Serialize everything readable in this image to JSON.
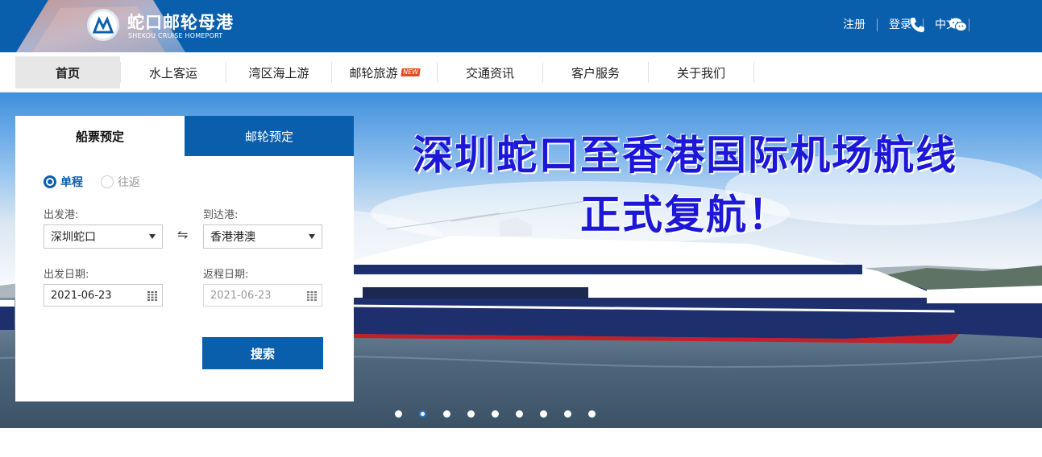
{
  "brand": {
    "name_cn": "蛇口邮轮母港",
    "name_en": "SHEKOU CRUISE HOMEPORT",
    "primary_color": "#0a5fad"
  },
  "top_links": {
    "register": "注册",
    "login": "登录",
    "language": "中文",
    "phone_icon": "phone-icon",
    "wechat_icon": "wechat-icon"
  },
  "nav": {
    "items": [
      {
        "label": "首页",
        "active": true
      },
      {
        "label": "水上客运"
      },
      {
        "label": "湾区海上游"
      },
      {
        "label": "邮轮旅游",
        "badge": "NEW"
      },
      {
        "label": "交通资讯"
      },
      {
        "label": "客户服务"
      },
      {
        "label": "关于我们"
      }
    ]
  },
  "banner": {
    "line1": "深圳蛇口至香港国际机场航线",
    "line2": "正式复航！",
    "slide_count": 9,
    "active_slide": 2
  },
  "booking": {
    "tabs": [
      "船票预定",
      "邮轮预定"
    ],
    "trip_types": [
      "单程",
      "往返"
    ],
    "selected_trip": "单程",
    "from_label": "出发港:",
    "to_label": "到达港:",
    "from_value": "深圳蛇口",
    "to_value": "香港港澳",
    "depart_date_label": "出发日期:",
    "return_date_label": "返程日期:",
    "depart_date": "2021-06-23",
    "return_date": "2021-06-23",
    "swap_symbol": "⇋",
    "search_label": "搜索"
  }
}
